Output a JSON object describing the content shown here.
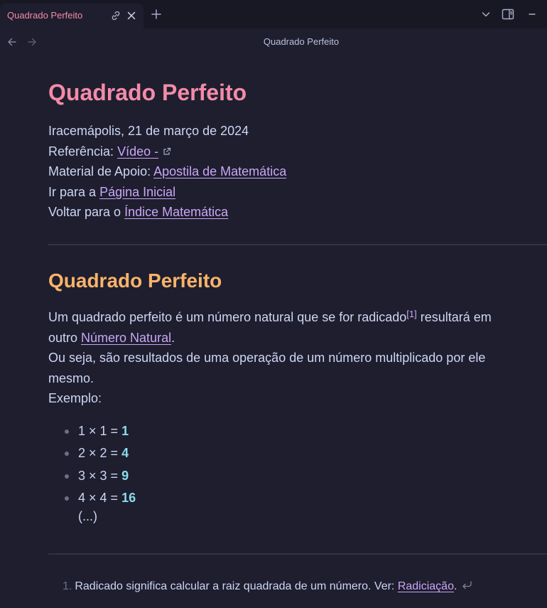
{
  "tab": {
    "title": "Quadrado Perfeito"
  },
  "nav": {
    "title": "Quadrado Perfeito"
  },
  "note": {
    "title": "Quadrado Perfeito",
    "meta": {
      "place_date": "Iracemápolis, 21 de março de 2024",
      "ref_label": "Referência:",
      "ref_link": "Vídeo -",
      "material_label": "Material de Apoio:",
      "material_link": "Apostila de Matemática",
      "home_label": "Ir para a",
      "home_link": "Página Inicial",
      "index_label": "Voltar para o",
      "index_link": "Índice Matemática"
    },
    "section": {
      "heading": "Quadrado Perfeito",
      "p1_before": "Um quadrado perfeito é um número natural que se for radicado",
      "footnote_ref": "[1]",
      "p1_after": " resultará em",
      "p2_before": "outro ",
      "p2_link": "Número Natural",
      "p2_after": ".",
      "p3": "Ou seja, são resultados de uma operação de um número multiplicado por ele",
      "p4": "mesmo.",
      "p5": "Exemplo:",
      "examples": [
        {
          "expr": "1 × 1 = ",
          "result": "1"
        },
        {
          "expr": "2 × 2 = ",
          "result": "4"
        },
        {
          "expr": "3 × 3 = ",
          "result": "9"
        },
        {
          "expr": "4 × 4 = ",
          "result": "16"
        }
      ],
      "ellipsis": "(...)"
    },
    "footnotes": [
      {
        "num": "1.",
        "text": "Radicado significa calcular a raiz quadrada de um número. Ver: ",
        "link": "Radiciação",
        "after": "."
      }
    ]
  },
  "colors": {
    "background": "#1e1e2e",
    "title": "#f38ba8",
    "heading2": "#f9b36a",
    "link": "#cba6f7",
    "result": "#89dceb"
  },
  "icons": [
    "link-icon",
    "close-icon",
    "plus-icon",
    "chevron-down-icon",
    "sidebar-toggle-icon",
    "minimize-icon",
    "arrow-left-icon",
    "arrow-right-icon",
    "external-link-icon",
    "return-arrow-icon"
  ]
}
